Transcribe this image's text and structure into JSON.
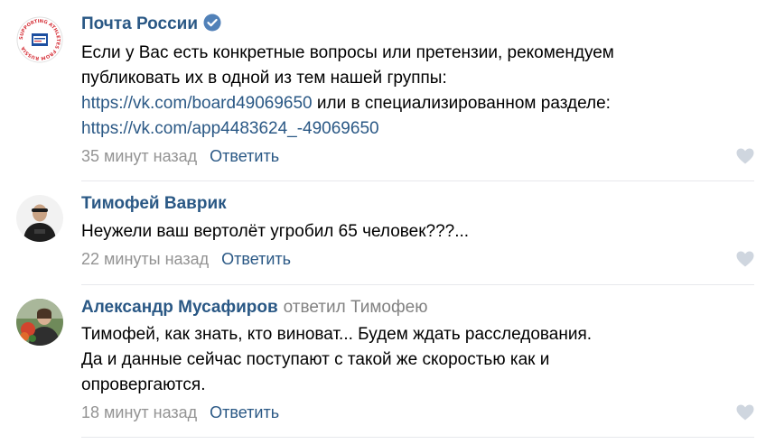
{
  "comments": [
    {
      "author": "Почта России",
      "verified": true,
      "lines": [
        {
          "text": "Если у Вас есть конкретные вопросы или претензии, рекомендуем"
        },
        {
          "text": "публиковать их в одной из тем нашей группы:"
        },
        {
          "link": "https://vk.com/board49069650",
          "text": " или в специализированном разделе:"
        },
        {
          "link": "https://vk.com/app4483624_-49069650"
        }
      ],
      "time": "35 минут назад",
      "reply_label": "Ответить",
      "avatar_text": "SUPPORTING ATHLETES FROM RUSSIA"
    },
    {
      "author": "Тимофей Ваврик",
      "lines": [
        {
          "text": "Неужели ваш вертолёт угробил 65 человек???..."
        }
      ],
      "time": "22 минуты назад",
      "reply_label": "Ответить"
    },
    {
      "author": "Александр Мусафиров",
      "reply_to": "ответил Тимофею",
      "lines": [
        {
          "text": "Тимофей, как знать, кто виноват... Будем ждать расследования."
        },
        {
          "text": "Да и данные сейчас поступают с такой же скоростью как и"
        },
        {
          "text": "опровергаются."
        }
      ],
      "time": "18 минут назад",
      "reply_label": "Ответить"
    }
  ],
  "colors": {
    "link": "#2a5885",
    "meta": "#939393",
    "divider": "#e7e8ec",
    "verified": "#5181b8",
    "like": "#cfd6df"
  },
  "icons": [
    "verified-icon",
    "heart-icon"
  ]
}
